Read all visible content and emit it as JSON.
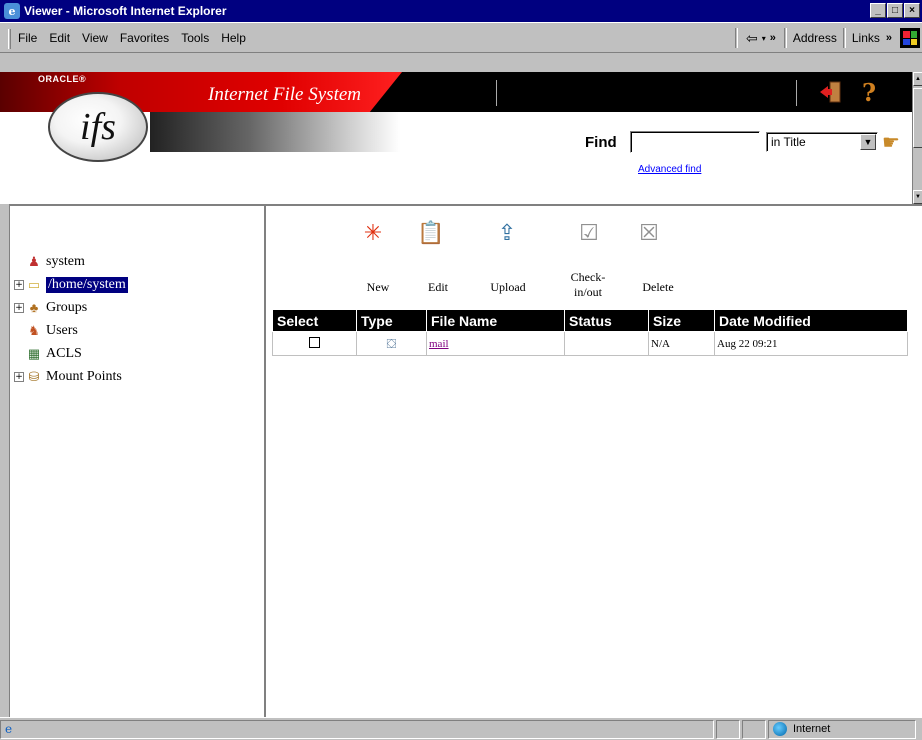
{
  "window": {
    "title": "Viewer - Microsoft Internet Explorer"
  },
  "menu": {
    "items": [
      "File",
      "Edit",
      "View",
      "Favorites",
      "Tools",
      "Help"
    ],
    "address_label": "Address",
    "links_label": "Links"
  },
  "header": {
    "oracle_label": "ORACLE®",
    "logo_text": "ifs",
    "app_title": "Internet File System",
    "find_label": "Find",
    "find_value": "",
    "find_scope": "in Title",
    "advanced_find": "Advanced find"
  },
  "tree": {
    "items": [
      {
        "label": "system",
        "icon": "user-icon"
      },
      {
        "label": "/home/system",
        "icon": "folder-icon",
        "selected": true
      },
      {
        "label": "Groups",
        "icon": "groups-icon"
      },
      {
        "label": "Users",
        "icon": "users-icon"
      },
      {
        "label": "ACLS",
        "icon": "acls-icon"
      },
      {
        "label": "Mount Points",
        "icon": "mount-points-icon"
      }
    ]
  },
  "actions": {
    "new": "New",
    "edit": "Edit",
    "upload": "Upload",
    "checkin_line1": "Check-",
    "checkin_line2": "in/out",
    "delete": "Delete"
  },
  "table": {
    "headers": [
      "Select",
      "Type",
      "File Name",
      "Status",
      "Size",
      "Date Modified"
    ],
    "rows": [
      {
        "file_name": "mail",
        "status": "",
        "size": "N/A",
        "date_modified": "Aug 22 09:21"
      }
    ]
  },
  "status": {
    "zone": "Internet"
  },
  "colors": {
    "title_bar": "#000080",
    "brand_red": "#e00000",
    "selection": "#000080"
  }
}
